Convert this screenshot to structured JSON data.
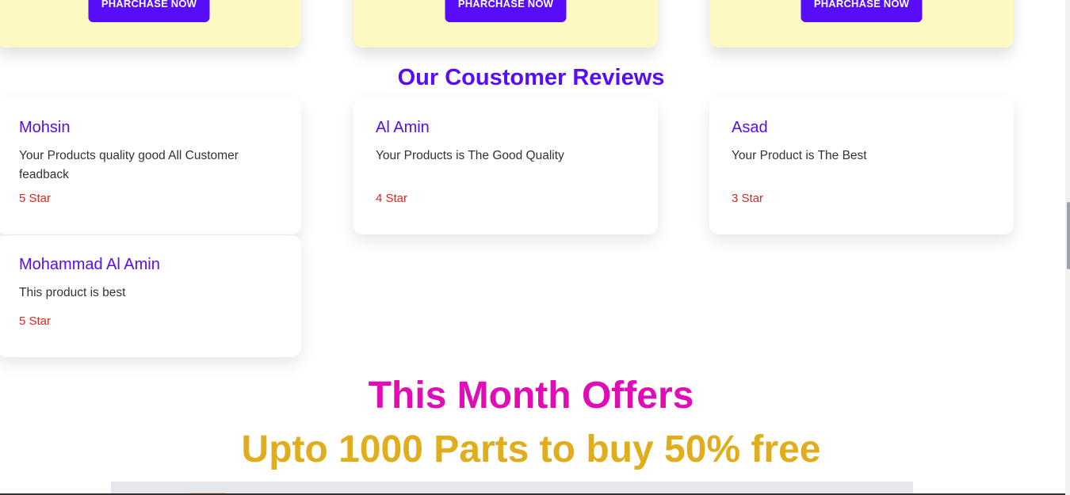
{
  "products": {
    "buttons": [
      "PHARCHASE NOW",
      "PHARCHASE NOW",
      "PHARCHASE NOW"
    ]
  },
  "reviews": {
    "title": "Our Coustomer Reviews",
    "items": [
      {
        "name": "Mohsin",
        "text": "Your Products quality good All Customer feadback",
        "stars": "5 Star"
      },
      {
        "name": "Al Amin",
        "text": "Your Products is The Good Quality",
        "stars": "4 Star"
      },
      {
        "name": "Asad",
        "text": "Your Product is The Best",
        "stars": "3 Star"
      },
      {
        "name": "Mohammad Al Amin",
        "text": "This product is best",
        "stars": "5 Star"
      }
    ]
  },
  "offers": {
    "title": "This Month Offers",
    "subtitle": "Upto 1000 Parts to buy 50% free"
  },
  "colors": {
    "primary": "#570df8",
    "card_yellow": "#fef9c3",
    "star_red": "#dc2626",
    "offer_pink": "#e10cb5",
    "offer_gold": "#e0ad1d"
  }
}
